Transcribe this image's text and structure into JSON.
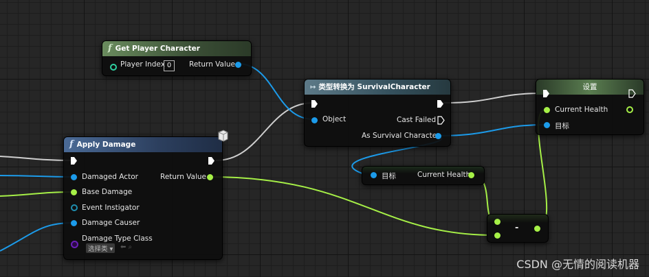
{
  "nodes": {
    "get_player_character": {
      "title": "Get Player Character",
      "player_index_label": "Player Index",
      "player_index_value": "0",
      "return_label": "Return Value"
    },
    "cast": {
      "title": "类型转换为 SurvivalCharacter",
      "object_label": "Object",
      "cast_failed_label": "Cast Failed",
      "as_label": "As Survival Character"
    },
    "set": {
      "title": "设置",
      "current_health_label": "Current Health",
      "target_label": "目标"
    },
    "apply_damage": {
      "title": "Apply Damage",
      "damaged_actor": "Damaged Actor",
      "base_damage": "Base Damage",
      "event_instigator": "Event Instigator",
      "damage_causer": "Damage Causer",
      "damage_type_class": "Damage Type Class",
      "select_class": "选择类",
      "return_label": "Return Value"
    },
    "get_health": {
      "target_label": "目标",
      "current_health_label": "Current Health"
    },
    "subtract": {
      "op": "-"
    }
  },
  "icons": [
    "function-icon",
    "cast-arrow-icon",
    "exec-pin-icon",
    "data-pin-icon",
    "network-cube-icon"
  ],
  "colors": {
    "exec": "#ffffff",
    "object": "#1c9bea",
    "float": "#a6f047",
    "class": "#6a1fb7",
    "wire_exec": "#cfcfcf"
  },
  "watermark": "CSDN @无情的阅读机器"
}
